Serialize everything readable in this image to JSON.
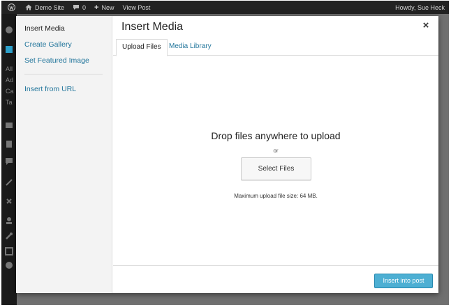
{
  "adminbar": {
    "site_name": "Demo Site",
    "comments_count": "0",
    "new_label": "New",
    "view_post_label": "View Post",
    "howdy": "Howdy, Sue Heck"
  },
  "adminmenu": {
    "letters": [
      "All",
      "Ad",
      "Ca",
      "Ta"
    ]
  },
  "sidebar": {
    "items": [
      {
        "label": "Insert Media",
        "active": true
      },
      {
        "label": "Create Gallery",
        "active": false
      },
      {
        "label": "Set Featured Image",
        "active": false
      },
      {
        "label": "Insert from URL",
        "active": false
      }
    ]
  },
  "modal": {
    "title": "Insert Media",
    "close_glyph": "×",
    "tabs": [
      {
        "label": "Upload Files",
        "active": true
      },
      {
        "label": "Media Library",
        "active": false
      }
    ],
    "drop_title": "Drop files anywhere to upload",
    "drop_or": "or",
    "select_files_label": "Select Files",
    "max_size_text": "Maximum upload file size: 64 MB.",
    "insert_button_label": "Insert into post"
  },
  "colors": {
    "link": "#21759b",
    "primary_button": "#2ea2cc",
    "admin_bar": "#222222"
  },
  "icons": [
    "wordpress-icon",
    "home-icon",
    "comment-icon",
    "plus-icon",
    "close-icon"
  ]
}
